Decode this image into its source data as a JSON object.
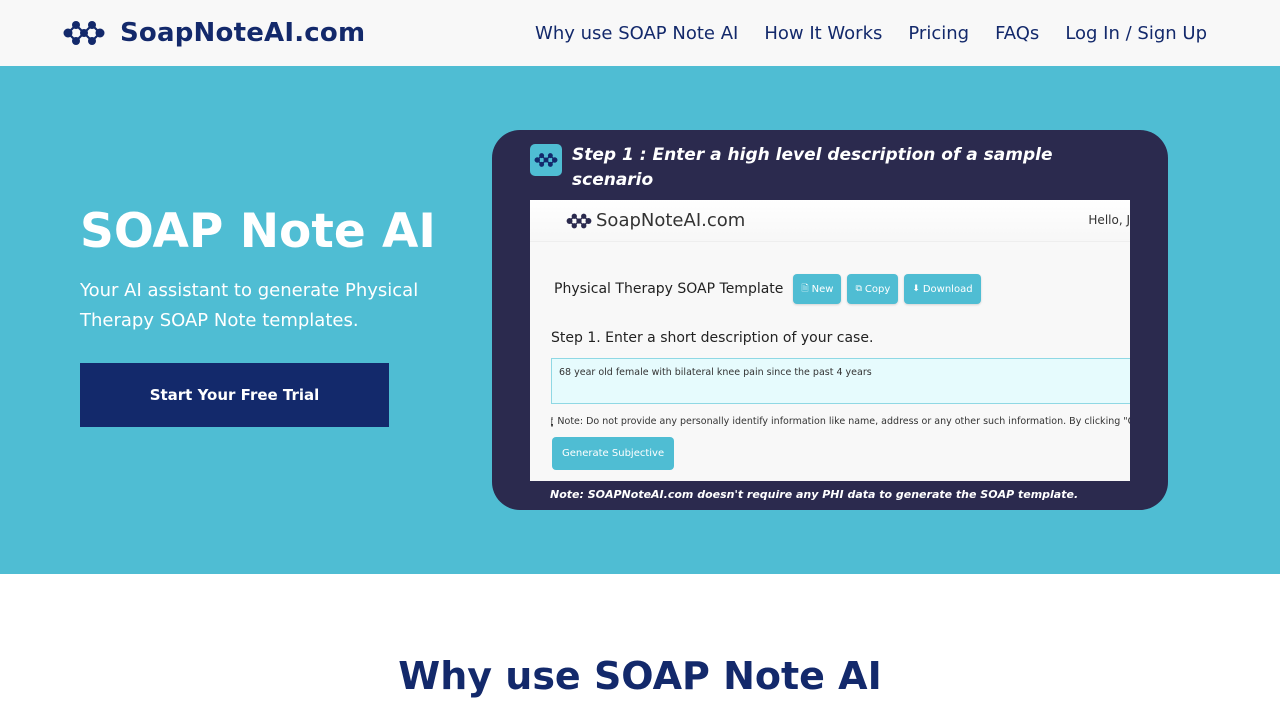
{
  "colors": {
    "brand_navy": "#13296b",
    "hero_bg": "#4fbdd3",
    "card_bg": "#2b2a4e",
    "accent": "#4fbdd3"
  },
  "header": {
    "brand": "SoapNoteAI.com",
    "logo_icon": "molecule-logo-icon",
    "nav": [
      "Why use SOAP Note AI",
      "How It Works",
      "Pricing",
      "FAQs",
      "Log In / Sign Up"
    ]
  },
  "hero": {
    "title": "SOAP Note AI",
    "subtitle": "Your AI assistant to generate Physical Therapy SOAP Note templates.",
    "cta": "Start Your Free Trial"
  },
  "demo": {
    "step_icon": "molecule-logo-icon",
    "step_title": "Step 1 : Enter a high level description of a sample scenario",
    "note": "Note: SOAPNoteAI.com doesn't require any PHI data to generate the SOAP template.",
    "app": {
      "brand": "SoapNoteAI.com",
      "greeting": "Hello, J",
      "template_title": "Physical Therapy SOAP Template",
      "buttons": [
        {
          "icon": "file-icon",
          "label": "New"
        },
        {
          "icon": "copy-icon",
          "label": "Copy"
        },
        {
          "icon": "download-icon",
          "label": "Download"
        }
      ],
      "step_label": "Step 1. Enter a short description of your case.",
      "case_value": "68 year old female with bilateral knee pain since the past 4 years",
      "privacy_note": "Note: Do not provide any personally identify information like name, address or any other such information. By clicking \"Gen",
      "generate_button": "Generate Subjective"
    }
  },
  "section": {
    "title": "Why use SOAP Note AI"
  }
}
